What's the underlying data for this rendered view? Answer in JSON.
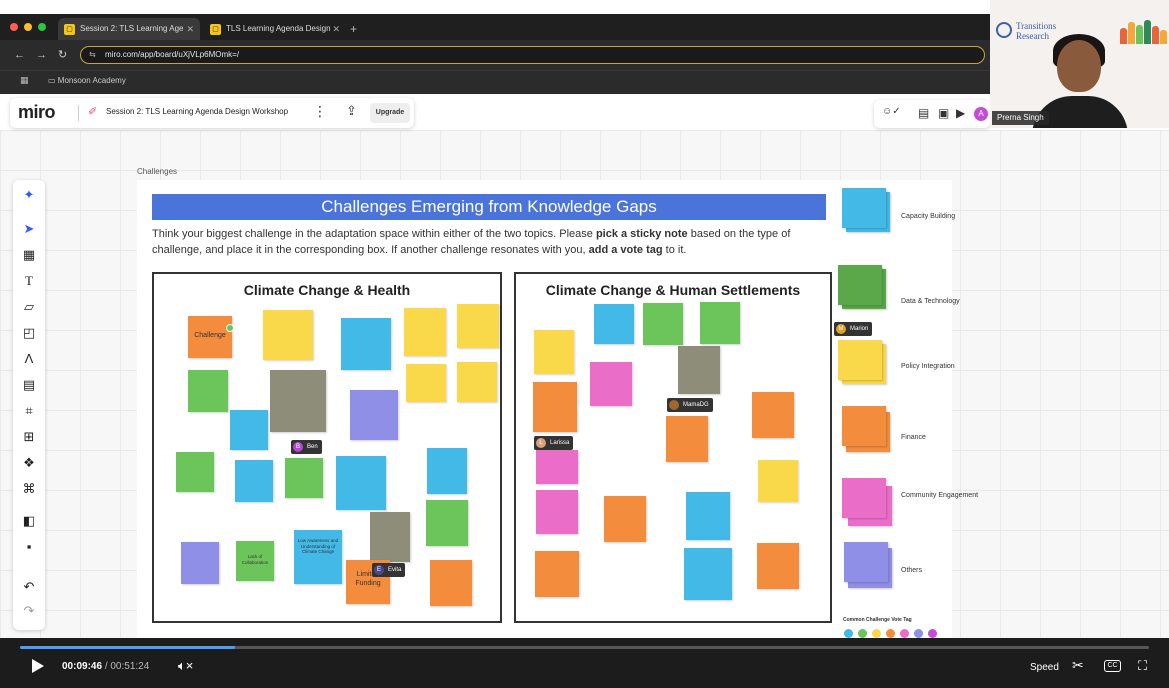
{
  "browser": {
    "tabs": [
      {
        "label": "Session 2: TLS Learning Age",
        "active": true
      },
      {
        "label": "TLS Learning Agenda Design",
        "active": false
      }
    ],
    "new_tab": "+",
    "url": "miro.com/app/board/uXjVLp6MOmk=/",
    "bookmark_folder": "Monsoon Academy"
  },
  "miro": {
    "logo": "miro",
    "board_title": "Session 2: TLS Learning Agenda Design Workshop",
    "more": "⋮",
    "upgrade_label": "Upgrade",
    "avatar_initial": "A"
  },
  "frame": {
    "label": "Challenges",
    "banner": "Challenges Emerging from Knowledge Gaps",
    "instructions": {
      "part1": "Think your biggest challenge in the adaptation space within either of the two topics. Please ",
      "bold1": "pick a sticky note",
      "part2": " based on the type of challenge, and place it in the corresponding box. If another challenge resonates with you, ",
      "bold2": "add a vote tag",
      "part3": " to it."
    },
    "topics": {
      "health": "Climate Change & Health",
      "settlements": "Climate Change & Human Settlements"
    },
    "notes": {
      "challenge": "Challenge",
      "limited_funding": "Limited Funding",
      "lack_of_collab": "Lack of Collaboration",
      "low_awareness": "Low Awareness and Understanding of Climate Change"
    },
    "tags": {
      "ben": {
        "initial": "B",
        "name": "Ben"
      },
      "evita": {
        "initial": "E",
        "name": "Evita"
      },
      "mamadg": {
        "initial": "",
        "name": "MamaDG"
      },
      "larissa": {
        "initial": "L",
        "name": "Larissa"
      },
      "marion": {
        "initial": "M",
        "name": "Marion"
      }
    },
    "legend": [
      {
        "label": "Capacity Building",
        "color": "#43b9e8"
      },
      {
        "label": "Data & Technology",
        "color": "#5aa84a"
      },
      {
        "label": "Policy Integration",
        "color": "#f9d949"
      },
      {
        "label": "Finance",
        "color": "#f48c3d"
      },
      {
        "label": "Community Engagement",
        "color": "#ea6ec8"
      },
      {
        "label": "Others",
        "color": "#8f8fe8"
      }
    ],
    "vote_tag_label": "Common Challenge Vote Tag",
    "vote_colors": [
      "#43b9e8",
      "#6cc55a",
      "#f9d949",
      "#f48c3d",
      "#ea6ec8",
      "#8f8fe8",
      "#c44dd8"
    ]
  },
  "webcam": {
    "org_name": "Transitions Research",
    "participant": "Prerna Singh"
  },
  "player": {
    "current_time": "00:09:46",
    "separator": "/",
    "total_time": "00:51:24",
    "progress": 0.19,
    "speed_label": "Speed",
    "cc_label": "CC"
  }
}
